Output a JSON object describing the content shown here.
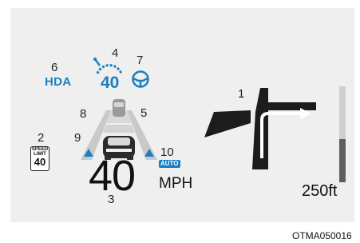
{
  "callouts": {
    "c1": "1",
    "c2": "2",
    "c3": "3",
    "c4": "4",
    "c5": "5",
    "c6": "6",
    "c7": "7",
    "c8": "8",
    "c9": "9",
    "c10": "10"
  },
  "hda_label": "HDA",
  "set_speed": "40",
  "speed_limit_sign": {
    "line1": "SPEED",
    "line2": "LIMIT",
    "value": "40"
  },
  "vehicle_speed": "40",
  "auto_badge": "AUTO",
  "speed_unit": "MPH",
  "turn_distance": "250ft",
  "distance_bar_fill": 0.45,
  "image_code": "OTMA050016",
  "icons": {
    "set_speed": "set-speed-gauge-icon",
    "steering": "steering-wheel-icon",
    "vehicle": "host-vehicle-icon",
    "lead_vehicle": "lead-vehicle-icon",
    "turn": "turn-arrow-icon"
  },
  "colors": {
    "accent": "#1a7fc1",
    "lane_gray": "#c6c6c6",
    "road_dark": "#1c1c1c"
  }
}
